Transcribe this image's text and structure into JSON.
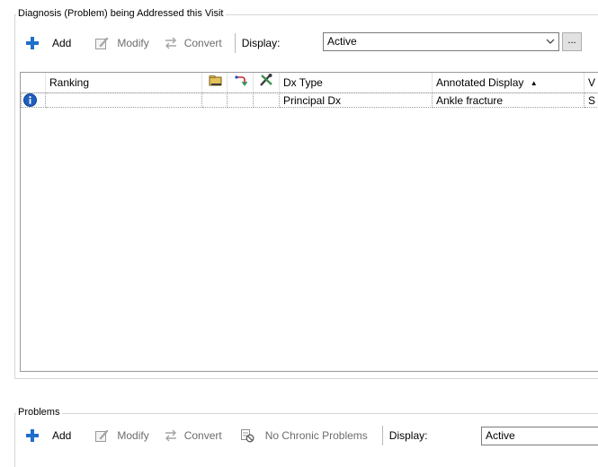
{
  "diagnosis": {
    "title": "Diagnosis (Problem) being Addressed this Visit",
    "toolbar": {
      "add": "Add",
      "modify": "Modify",
      "convert": "Convert",
      "display_label": "Display:",
      "display_value": "Active",
      "ellipsis": "..."
    },
    "columns": {
      "ranking": "Ranking",
      "dx_type": "Dx Type",
      "annotated_display": "Annotated Display",
      "sort_indicator": "▲",
      "next_col": "V"
    },
    "rows": [
      {
        "ranking": "",
        "dx_type": "Principal Dx",
        "annotated_display": "Ankle fracture",
        "next_col": "S"
      }
    ]
  },
  "problems": {
    "title": "Problems",
    "toolbar": {
      "add": "Add",
      "modify": "Modify",
      "convert": "Convert",
      "no_chronic": "No Chronic Problems",
      "display_label": "Display:",
      "display_value": "Active"
    }
  },
  "icons": {
    "add": "plus-icon",
    "modify": "edit-icon",
    "convert": "convert-arrows-icon",
    "no_chronic": "no-chronic-icon",
    "info": "info-icon"
  },
  "colors": {
    "add_plus": "#1e6fc9",
    "info": "#1f5fbf",
    "disabled_text": "#6d6d6d"
  }
}
